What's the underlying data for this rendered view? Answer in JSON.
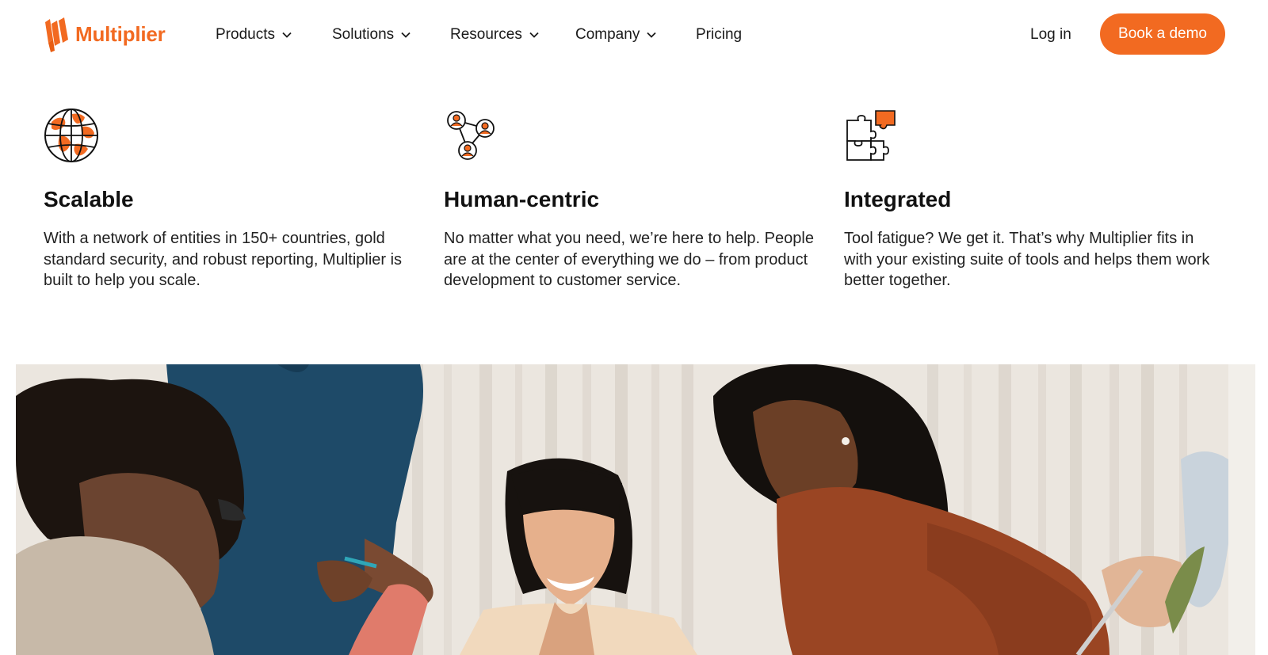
{
  "brand": {
    "name": "Multiplier",
    "accent_color": "#f26a21"
  },
  "nav": {
    "items": [
      {
        "label": "Products",
        "has_dropdown": true
      },
      {
        "label": "Solutions",
        "has_dropdown": true
      },
      {
        "label": "Resources",
        "has_dropdown": true
      },
      {
        "label": "Company",
        "has_dropdown": true
      },
      {
        "label": "Pricing",
        "has_dropdown": false
      }
    ],
    "login_label": "Log in",
    "cta_label": "Book a demo"
  },
  "features": [
    {
      "icon": "globe-icon",
      "title": "Scalable",
      "description": "With a network of entities in 150+ countries, gold standard security, and robust reporting, Multiplier is built to help you scale."
    },
    {
      "icon": "people-network-icon",
      "title": "Human-centric",
      "description": "No matter what you need, we’re here to help. People are at the center of everything we do – from product development to customer service."
    },
    {
      "icon": "puzzle-icon",
      "title": "Integrated",
      "description": "Tool fatigue? We get it. That’s why Multiplier fits in with your existing suite of tools and helps them work better together."
    }
  ],
  "hero_image": {
    "subject": "team-collaboration-photo"
  }
}
